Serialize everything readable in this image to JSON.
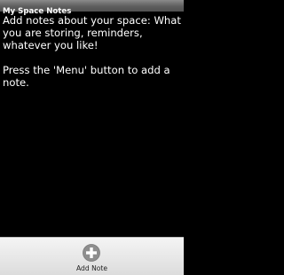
{
  "app": {
    "title": "My Space Notes"
  },
  "main": {
    "paragraphs": [
      "Add notes about your space: What you are storing, reminders, whatever you like!",
      "Press the 'Menu' button to add a note."
    ]
  },
  "menu": {
    "items": [
      {
        "label": "Add Note",
        "icon": "plus-circle-icon"
      }
    ]
  },
  "colors": {
    "background": "#000000",
    "text": "#ffffff",
    "menu_background": "#e8e8e8",
    "icon": "#8e8e8e"
  }
}
